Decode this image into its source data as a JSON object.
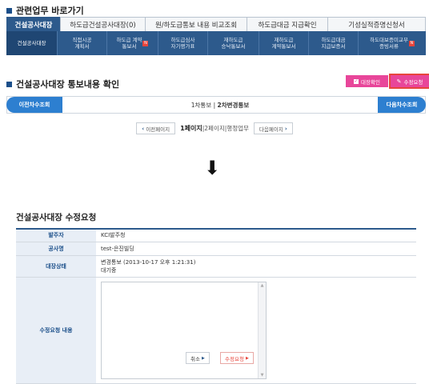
{
  "section1_title": "관련업무 바로가기",
  "tabs": [
    {
      "label": "건설공사대장",
      "active": true
    },
    {
      "label": "하도급건설공사대장(0)",
      "active": false
    },
    {
      "label": "원/하도급통보 내용 비교조회",
      "active": false
    },
    {
      "label": "하도급대금 지급확인",
      "active": false
    },
    {
      "label": "기성실적증명신청서",
      "active": false
    }
  ],
  "subtabs": [
    {
      "label": "건설공사대장",
      "active": true,
      "badge": false
    },
    {
      "label": "직접시공\n계획서",
      "active": false,
      "badge": false
    },
    {
      "label": "하도급 계약\n통보서",
      "active": false,
      "badge": true
    },
    {
      "label": "하도급심사\n자기평가표",
      "active": false,
      "badge": false
    },
    {
      "label": "재하도급\n승낙통보서",
      "active": false,
      "badge": false
    },
    {
      "label": "재하도급\n계약통보서",
      "active": false,
      "badge": false
    },
    {
      "label": "하도급대금\n지급보증서",
      "active": false,
      "badge": false
    },
    {
      "label": "하도대보증미교부\n증빙서류",
      "active": false,
      "badge": true
    }
  ],
  "section2_title": "건설공사대장 통보내용 확인",
  "btn_confirm": "대장확인",
  "btn_request": "수정요청",
  "chasu": {
    "prev": "이전차수조회",
    "current": "1차통보 | ",
    "current_bold": "2차변경통보",
    "next": "다음차수조회"
  },
  "pager": {
    "prev": "이전페이지",
    "p1": "1페이지",
    "sep1": " | ",
    "p2": "2페이지",
    "sep2": " | ",
    "admin": "행정업무",
    "next": "다음페이지"
  },
  "arrow": "⬇",
  "form_title": "건설공사대장 수정요청",
  "form": {
    "client_label": "발주자",
    "client_value": "KCI발주청",
    "project_label": "공사명",
    "project_value": "test-은진빌딩",
    "status_label": "대장상태",
    "status_value1": "변경통보 (2013-10-17 오후 1:21:31)",
    "status_value2": "대기중",
    "content_label": "수정요청 내용"
  },
  "btn_cancel": "취소",
  "btn_submit": "수정요청",
  "colors": {
    "navy": "#2d5a8c",
    "pink": "#e8469a",
    "blue": "#2d7fd0",
    "red": "#e8453c"
  }
}
